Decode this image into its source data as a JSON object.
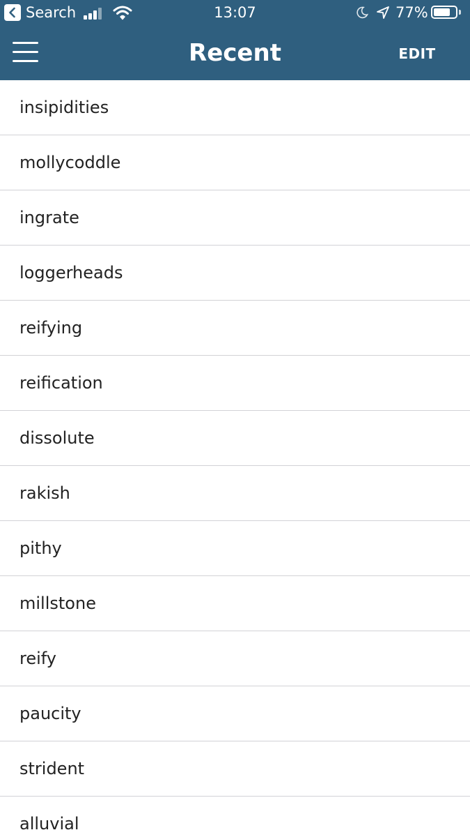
{
  "colors": {
    "header_bg": "#2f5f7f",
    "header_text": "#ffffff",
    "divider": "#d2d2d6",
    "row_text": "#222222"
  },
  "status_bar": {
    "back_app": "Search",
    "time": "13:07",
    "battery": "77%",
    "battery_level": 0.77,
    "icons": [
      "back-chevron-icon",
      "signal-icon",
      "wifi-icon",
      "moon-icon",
      "location-arrow-icon",
      "battery-icon"
    ]
  },
  "nav": {
    "menu_icon": "hamburger-menu-icon",
    "title": "Recent",
    "edit_label": "EDIT"
  },
  "words": [
    "insipidities",
    "mollycoddle",
    "ingrate",
    "loggerheads",
    "reifying",
    "reification",
    "dissolute",
    "rakish",
    "pithy",
    "millstone",
    "reify",
    "paucity",
    "strident",
    "alluvial"
  ]
}
